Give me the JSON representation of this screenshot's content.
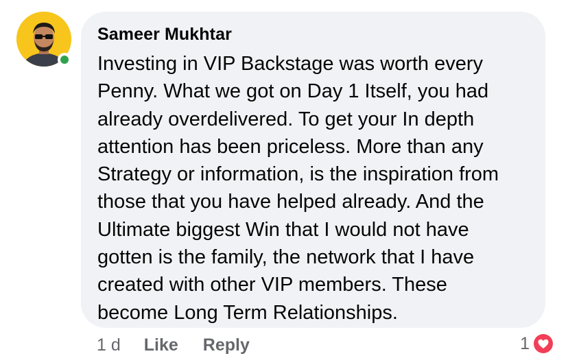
{
  "comment": {
    "author": "Sameer Mukhtar",
    "lines": [
      "Investing in VIP Backstage was worth every",
      "Penny. What we got on Day 1 Itself, you had",
      "already overdelivered. To get your In depth",
      "attention has been priceless. More than any",
      "Strategy or information, is the inspiration from",
      "those that you have helped already. And the",
      "Ultimate biggest Win that I would not have",
      "gotten is the family, the network that I have",
      "created with other VIP members. These",
      "become Long Term Relationships."
    ],
    "online": true
  },
  "actions": {
    "time": "1 d",
    "like_label": "Like",
    "reply_label": "Reply"
  },
  "reactions": {
    "count": "1",
    "type_icon": "heart-icon"
  },
  "colors": {
    "bubble_bg": "#f0f2f5",
    "online_green": "#31a24c",
    "heart_red": "#f33e58",
    "meta_gray": "#65676b",
    "avatar_bg": "#f7c51c"
  }
}
